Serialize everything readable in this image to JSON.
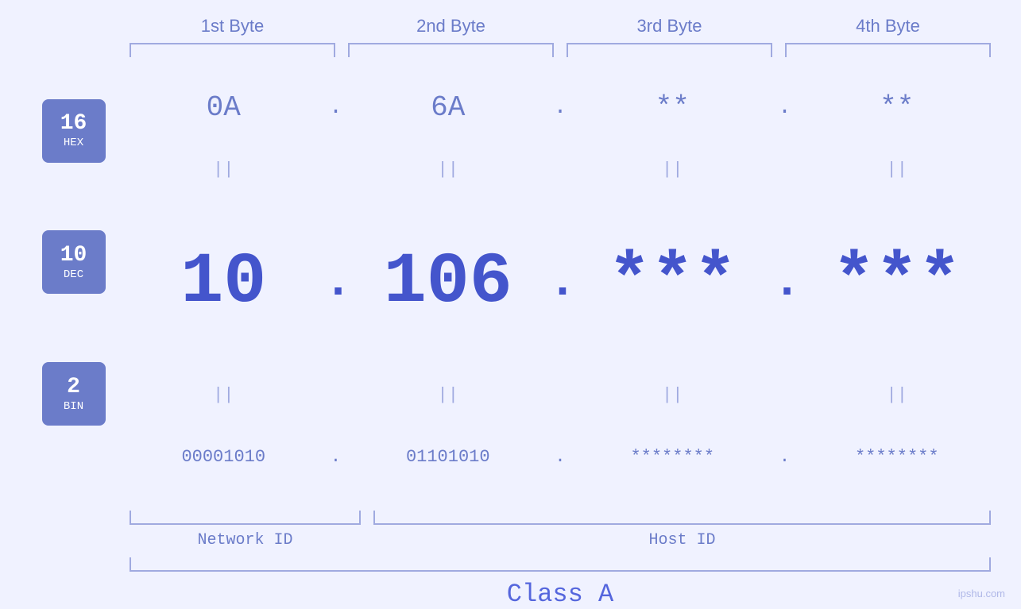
{
  "headers": {
    "byte1": "1st Byte",
    "byte2": "2nd Byte",
    "byte3": "3rd Byte",
    "byte4": "4th Byte"
  },
  "badges": {
    "hex": {
      "num": "16",
      "label": "HEX"
    },
    "dec": {
      "num": "10",
      "label": "DEC"
    },
    "bin": {
      "num": "2",
      "label": "BIN"
    }
  },
  "hex_row": {
    "b1": "0A",
    "b2": "6A",
    "b3": "**",
    "b4": "**",
    "dot": "."
  },
  "dec_row": {
    "b1": "10",
    "b2": "106",
    "b3": "***",
    "b4": "***",
    "dot": "."
  },
  "bin_row": {
    "b1": "00001010",
    "b2": "01101010",
    "b3": "********",
    "b4": "********",
    "dot": "."
  },
  "labels": {
    "network_id": "Network ID",
    "host_id": "Host ID",
    "class": "Class A"
  },
  "watermark": "ipshu.com",
  "colors": {
    "accent": "#6b7cc9",
    "dark_accent": "#4455cc",
    "light_accent": "#a0aae0",
    "bg": "#f0f2ff"
  }
}
